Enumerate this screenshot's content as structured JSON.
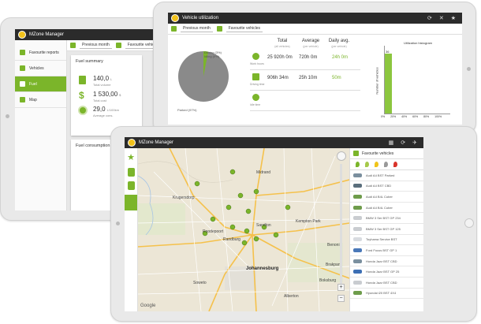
{
  "back_tablet": {
    "app_title": "MZone Manager",
    "subbar": {
      "period": "Previous month",
      "favourites": "Favourite vehicle"
    },
    "menu": [
      {
        "label": "Favourite reports",
        "active": false
      },
      {
        "label": "Vehicles",
        "active": false
      },
      {
        "label": "Fuel",
        "active": true
      },
      {
        "label": "Map",
        "active": false
      }
    ],
    "fuel_summary": {
      "title": "Fuel summary",
      "volume_value": "140,0",
      "volume_unit": "L",
      "volume_label": "Total volume",
      "cost_value": "1 530,00",
      "cost_unit": "$",
      "cost_label": "Total cost",
      "avg_value": "29,0",
      "avg_unit": "L/100km",
      "avg_label": "Average cons."
    },
    "fuel_consumption": {
      "title": "Fuel consumption"
    }
  },
  "mid_tablet": {
    "app_title": "Vehicle utilization",
    "subbar": {
      "period": "Previous month",
      "favourites": "Favourite vehicles"
    },
    "pie": {
      "label_top": "Driving (3%)",
      "label_top2": "Idling (0%)",
      "label_left": "Parked (97%)"
    },
    "table": {
      "headers": [
        "Total",
        "Average",
        "Daily avg."
      ],
      "subheaders": [
        "(all vehicles)",
        "(per vehicle)",
        "(per vehicle)"
      ],
      "rows": [
        {
          "label": "Work hours",
          "values": [
            "25 920h 0m",
            "720h 0m",
            "24h 0m"
          ]
        },
        {
          "label": "Driving time",
          "values": [
            "906h 34m",
            "25h 10m",
            "50m"
          ]
        },
        {
          "label": "Idle time",
          "values": [
            "",
            "",
            ""
          ]
        }
      ]
    },
    "histogram": {
      "title": "Utilization histogram",
      "ylabel": "Number of vehicles",
      "xticks": [
        "0%",
        "20%",
        "40%",
        "60%",
        "80%",
        "100%"
      ],
      "bar_label": "36"
    }
  },
  "front_tablet": {
    "app_title": "MZone Manager",
    "fav_header": "Favourite vehicles",
    "map_labels": [
      "Krugersdorp",
      "Roodepoort",
      "Soweto",
      "Johannesburg",
      "Midrand",
      "Sandton",
      "Randburg",
      "Alberton",
      "Boksburg",
      "Benoni",
      "Kempton Park",
      "Brakpan"
    ],
    "google": "Google",
    "vehicles": [
      {
        "name": "Audi A4 BST Parked",
        "color": "#7a8f9e"
      },
      {
        "name": "Audi A4 BST CBD",
        "color": "#5a6e7c"
      },
      {
        "name": "Audi A4 B4L Cuber",
        "color": "#6e9c4b"
      },
      {
        "name": "Audi A4 B4L Cuber",
        "color": "#6e9c4b"
      },
      {
        "name": "BMW 3 Ser BST GP 234",
        "color": "#c9ccd0"
      },
      {
        "name": "BMW 3 Ser BST GP 125",
        "color": "#c9ccd0"
      },
      {
        "name": "Toyhama Service BST",
        "color": "#d8dbe0"
      },
      {
        "name": "Ford Focus BST GP 1",
        "color": "#4a78b8"
      },
      {
        "name": "Honda Jazz BST CBD",
        "color": "#7a8f9e"
      },
      {
        "name": "Honda Jazz BST GP 25",
        "color": "#3d6fb4"
      },
      {
        "name": "Honda Jazz BST CBD",
        "color": "#c9ccd0"
      },
      {
        "name": "Hyundai i20 BST 4X4",
        "color": "#6e9c4b"
      }
    ],
    "colors": {
      "accent": "#7bb52a",
      "topbar": "#2b2b2b"
    }
  },
  "icons": [
    "star-icon",
    "list-icon",
    "fuel-pump-icon",
    "map-icon",
    "refresh-icon",
    "filter-icon",
    "dollar-icon",
    "gauge-icon"
  ]
}
